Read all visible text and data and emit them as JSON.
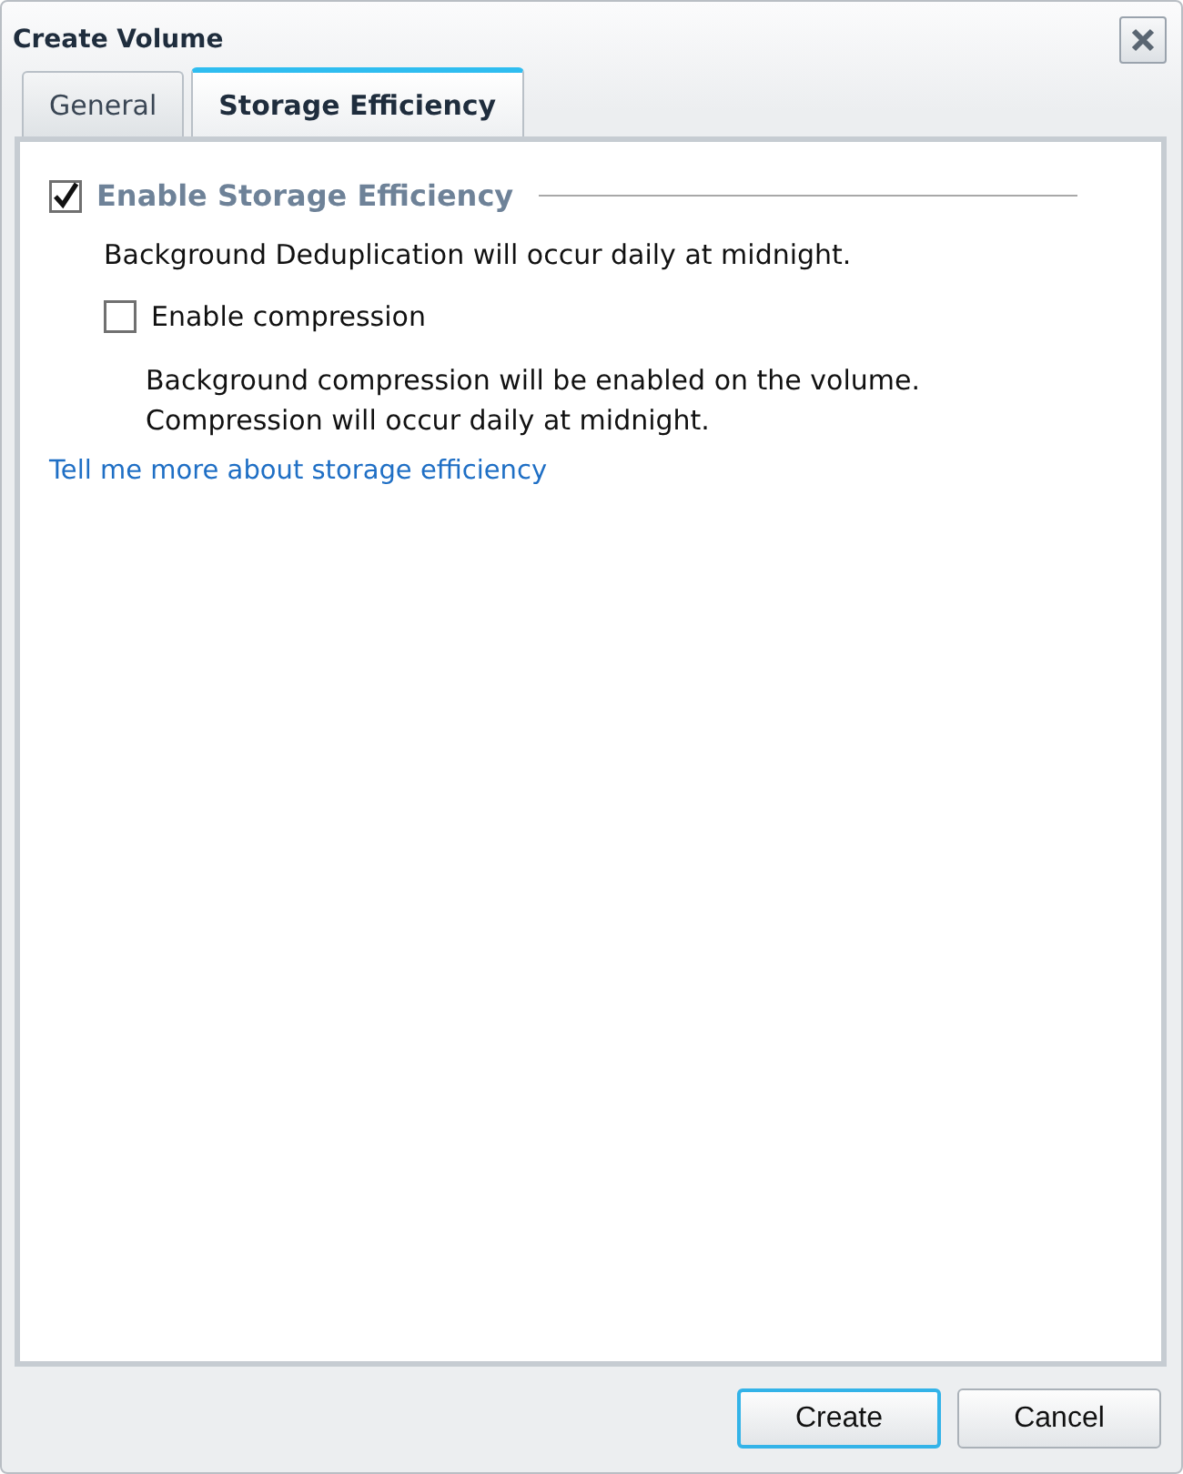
{
  "window": {
    "title": "Create Volume"
  },
  "tabs": [
    {
      "label": "General",
      "selected": false
    },
    {
      "label": "Storage Efficiency",
      "selected": true
    }
  ],
  "section": {
    "label": "Enable Storage Efficiency",
    "checked": true,
    "note": "Background Deduplication will occur daily at midnight.",
    "compression": {
      "label": "Enable compression",
      "checked": false,
      "notes": [
        "Background compression will be enabled on the volume.",
        "Compression will occur daily at midnight."
      ]
    }
  },
  "link": "Tell me more about storage efficiency",
  "buttons": [
    {
      "label": "Create",
      "focused": true
    },
    {
      "label": "Cancel",
      "focused": false
    }
  ]
}
